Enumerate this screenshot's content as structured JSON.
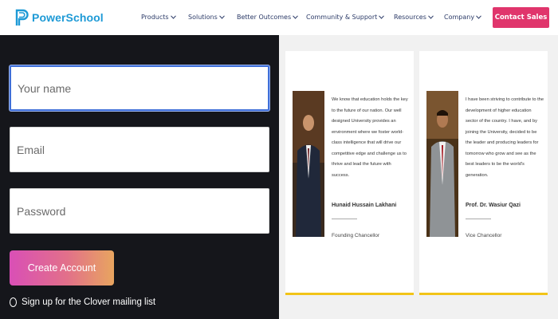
{
  "header": {
    "logo_text": "PowerSchool",
    "logo_icon": "powerschool-p-icon",
    "nav": [
      {
        "label": "Products",
        "icon": "chevron-down-icon"
      },
      {
        "label": "Solutions",
        "icon": "chevron-down-icon"
      },
      {
        "label": "Better Outcomes",
        "icon": "chevron-down-icon"
      },
      {
        "label": "Community & Support",
        "icon": "chevron-down-icon"
      },
      {
        "label": "Resources",
        "icon": "chevron-down-icon"
      },
      {
        "label": "Company",
        "icon": "chevron-down-icon"
      }
    ],
    "cta_label": "Contact Sales"
  },
  "signup": {
    "name_placeholder": "Your name",
    "email_placeholder": "Email",
    "password_placeholder": "Password",
    "create_label": "Create Account",
    "optin_label": "Sign up for the Clover mailing list"
  },
  "testimonials": [
    {
      "quote": "We know that education holds the key to the future of our nation. Our well designed University provides an environment where we foster world-class intelligence that will drive our competitive edge and challenge us to thrive and lead the future with success.",
      "name": "Hunaid Hussain Lakhani",
      "role": "Founding Chancellor"
    },
    {
      "quote": "I have been striving to contribute to the development of higher education sector of the country. I have, and by joining the University, decided to be the leader and producing leaders for tomorrow who grow and see as the best leaders to be the world's generation.",
      "name": "Prof. Dr. Wasiur Qazi",
      "role": "Vice Chancellor"
    }
  ],
  "colors": {
    "brand_blue": "#1e9ad6",
    "nav_text": "#2b3a67",
    "cta_pink": "#e0356c",
    "signup_bg": "#15161b",
    "focus_blue": "#3f6fd8",
    "card_accent": "#f2c418"
  }
}
